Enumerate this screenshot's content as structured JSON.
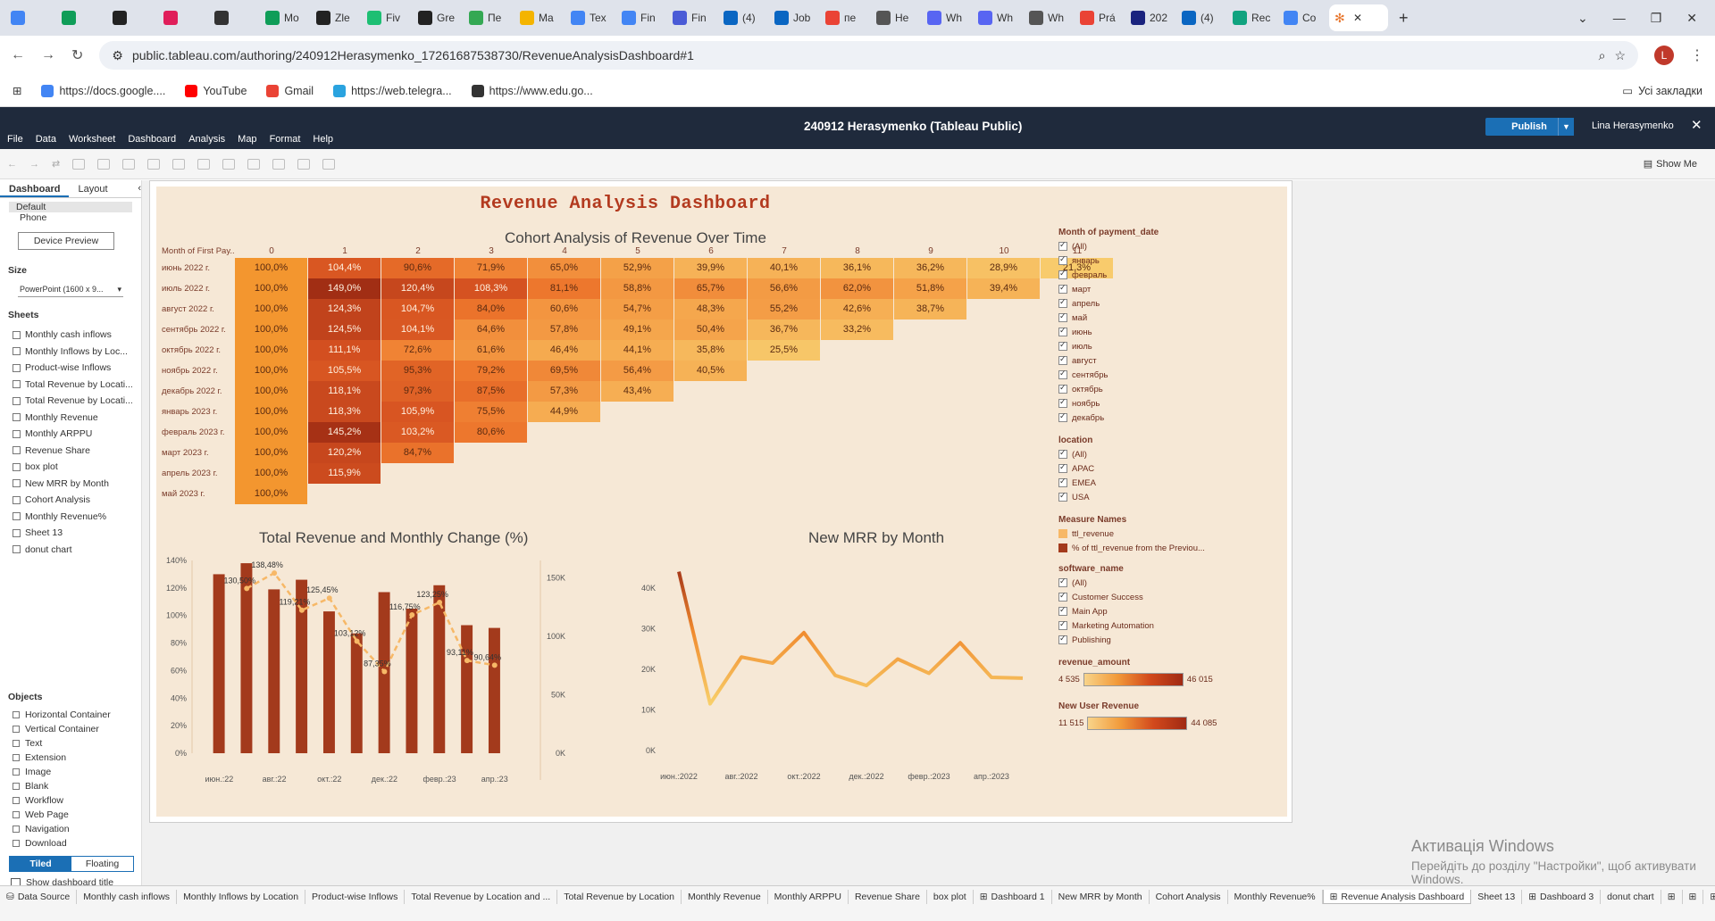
{
  "browser": {
    "tabs": [
      {
        "label": "",
        "color": "#4285f4"
      },
      {
        "label": "",
        "color": "#0f9d58"
      },
      {
        "label": "",
        "color": "#222"
      },
      {
        "label": "",
        "color": "#e01e5a"
      },
      {
        "label": "",
        "color": "#333"
      },
      {
        "label": "Mo",
        "color": "#0f9d58"
      },
      {
        "label": "Zle",
        "color": "#222"
      },
      {
        "label": "Fiv",
        "color": "#1dbf73"
      },
      {
        "label": "Gre",
        "color": "#222"
      },
      {
        "label": "Пе",
        "color": "#34a853"
      },
      {
        "label": "Ma",
        "color": "#f4b400"
      },
      {
        "label": "Tex",
        "color": "#4285f4"
      },
      {
        "label": "Fin",
        "color": "#4285f4"
      },
      {
        "label": "Fin",
        "color": "#4a5bd6"
      },
      {
        "label": "(4)",
        "color": "#0a66c2"
      },
      {
        "label": "Job",
        "color": "#0a66c2"
      },
      {
        "label": "пе",
        "color": "#ea4335"
      },
      {
        "label": "Не",
        "color": "#555"
      },
      {
        "label": "Wh",
        "color": "#5865f2"
      },
      {
        "label": "Wh",
        "color": "#5865f2"
      },
      {
        "label": "Wh",
        "color": "#555"
      },
      {
        "label": "Prá",
        "color": "#ea4335"
      },
      {
        "label": "202",
        "color": "#1a237e"
      },
      {
        "label": "(4)",
        "color": "#0a66c2"
      },
      {
        "label": "Rec",
        "color": "#10a37f"
      },
      {
        "label": "Co",
        "color": "#4285f4"
      }
    ],
    "active_tab_icon": "tableau-icon",
    "url": "public.tableau.com/authoring/240912Herasymenko_17261687538730/RevenueAnalysisDashboard#1",
    "avatar_letter": "L",
    "bookmarks": [
      {
        "label": "https://docs.google....",
        "color": "#4285f4"
      },
      {
        "label": "YouTube",
        "color": "#ff0000"
      },
      {
        "label": "Gmail",
        "color": "#ea4335"
      },
      {
        "label": "https://web.telegra...",
        "color": "#2aa3df"
      },
      {
        "label": "https://www.edu.go...",
        "color": "#333"
      }
    ],
    "all_bookmarks": "Усі закладки"
  },
  "tableau": {
    "menu": [
      "File",
      "Data",
      "Worksheet",
      "Dashboard",
      "Analysis",
      "Map",
      "Format",
      "Help"
    ],
    "title": "240912 Herasymenko (Tableau Public)",
    "publish": "Publish",
    "user": "Lina Herasymenko",
    "show_me": "Show Me"
  },
  "sidebar": {
    "tabs": [
      "Dashboard",
      "Layout"
    ],
    "device_options": [
      "Default",
      "Phone"
    ],
    "device_preview": "Device Preview",
    "size_label": "Size",
    "size_value": "PowerPoint (1600 x 9...",
    "sheets_label": "Sheets",
    "sheets": [
      "Monthly cash inflows",
      "Monthly Inflows by Loc...",
      "Product-wise Inflows",
      "Total Revenue by Locati...",
      "Total Revenue by Locati...",
      "Monthly Revenue",
      "Monthly ARPPU",
      "Revenue Share",
      "box plot",
      "New MRR by Month",
      "Cohort Analysis",
      "Monthly Revenue%",
      "Sheet 13",
      "donut chart"
    ],
    "objects_label": "Objects",
    "objects": [
      "Horizontal Container",
      "Vertical Container",
      "Text",
      "Extension",
      "Image",
      "Blank",
      "Workflow",
      "Web Page",
      "Navigation",
      "Download"
    ],
    "tiled": "Tiled",
    "floating": "Floating",
    "show_title": "Show dashboard title"
  },
  "dashboard": {
    "title": "Revenue Analysis Dashboard",
    "cohort_title": "Cohort Analysis of Revenue Over Time",
    "cohort_row_header": "Month of First Pay..",
    "cohort_cols": [
      "0",
      "1",
      "2",
      "3",
      "4",
      "5",
      "6",
      "7",
      "8",
      "9",
      "10",
      "11"
    ],
    "cohort_rows": [
      {
        "label": "июнь 2022 г.",
        "values": [
          "100,0%",
          "104,4%",
          "90,6%",
          "71,9%",
          "65,0%",
          "52,9%",
          "39,9%",
          "40,1%",
          "36,1%",
          "36,2%",
          "28,9%",
          "21,3%"
        ]
      },
      {
        "label": "июль 2022 г.",
        "values": [
          "100,0%",
          "149,0%",
          "120,4%",
          "108,3%",
          "81,1%",
          "58,8%",
          "65,7%",
          "56,6%",
          "62,0%",
          "51,8%",
          "39,4%"
        ]
      },
      {
        "label": "август 2022 г.",
        "values": [
          "100,0%",
          "124,3%",
          "104,7%",
          "84,0%",
          "60,6%",
          "54,7%",
          "48,3%",
          "55,2%",
          "42,6%",
          "38,7%"
        ]
      },
      {
        "label": "сентябрь 2022 г.",
        "values": [
          "100,0%",
          "124,5%",
          "104,1%",
          "64,6%",
          "57,8%",
          "49,1%",
          "50,4%",
          "36,7%",
          "33,2%"
        ]
      },
      {
        "label": "октябрь 2022 г.",
        "values": [
          "100,0%",
          "111,1%",
          "72,6%",
          "61,6%",
          "46,4%",
          "44,1%",
          "35,8%",
          "25,5%"
        ]
      },
      {
        "label": "ноябрь 2022 г.",
        "values": [
          "100,0%",
          "105,5%",
          "95,3%",
          "79,2%",
          "69,5%",
          "56,4%",
          "40,5%"
        ]
      },
      {
        "label": "декабрь 2022 г.",
        "values": [
          "100,0%",
          "118,1%",
          "97,3%",
          "87,5%",
          "57,3%",
          "43,4%"
        ]
      },
      {
        "label": "январь 2023 г.",
        "values": [
          "100,0%",
          "118,3%",
          "105,9%",
          "75,5%",
          "44,9%"
        ]
      },
      {
        "label": "февраль 2023 г.",
        "values": [
          "100,0%",
          "145,2%",
          "103,2%",
          "80,6%"
        ]
      },
      {
        "label": "март 2023 г.",
        "values": [
          "100,0%",
          "120,2%",
          "84,7%"
        ]
      },
      {
        "label": "апрель 2023 г.",
        "values": [
          "100,0%",
          "115,9%"
        ]
      },
      {
        "label": "май 2023 г.",
        "values": [
          "100,0%"
        ]
      }
    ],
    "legend": {
      "month_title": "Month of payment_date",
      "months": [
        "(All)",
        "январь",
        "февраль",
        "март",
        "апрель",
        "май",
        "июнь",
        "июль",
        "август",
        "сентябрь",
        "октябрь",
        "ноябрь",
        "декабрь"
      ],
      "location_title": "location",
      "locations": [
        "(All)",
        "APAC",
        "EMEA",
        "USA"
      ],
      "measure_title": "Measure Names",
      "measures": [
        {
          "label": "ttl_revenue",
          "color": "#f7b867"
        },
        {
          "label": "% of ttl_revenue from the Previou...",
          "color": "#a33a1c"
        }
      ],
      "software_title": "software_name",
      "software": [
        "(All)",
        "Customer Success",
        "Main App",
        "Marketing Automation",
        "Publishing"
      ],
      "revenue_amount_title": "revenue_amount",
      "revenue_amount_min": "4 535",
      "revenue_amount_max": "46 015",
      "new_user_title": "New User Revenue",
      "new_user_min": "11 515",
      "new_user_max": "44 085"
    }
  },
  "chart_data": [
    {
      "type": "bar",
      "title": "Total Revenue and Monthly Change (%)",
      "categories": [
        "июн.:22",
        "июл.:22",
        "авг.:22",
        "сент.:22",
        "окт.:22",
        "нояб.:22",
        "дек.:22",
        "янв.:23",
        "февр.:23",
        "март:23",
        "апр.:23",
        "май:23"
      ],
      "x_tick_labels": [
        "июн.:22",
        "авг.:22",
        "окт.:22",
        "дек.:22",
        "февр.:23",
        "апр.:23"
      ],
      "series": [
        {
          "name": "ttl_revenue",
          "type": "bar",
          "color": "#a33a1c",
          "values": [
            130,
            138,
            119,
            126,
            103,
            87,
            117,
            105,
            122,
            93,
            91
          ]
        },
        {
          "name": "% of ttl_revenue from the Previou...",
          "type": "line",
          "color": "#f7b867",
          "values": [
            null,
            130.5,
            138.48,
            119.21,
            125.45,
            103.12,
            87.35,
            116.75,
            123.25,
            93.11,
            90.64
          ],
          "labels": [
            "",
            "130,50%",
            "138,48%",
            "119,21%",
            "125,45%",
            "103,12%",
            "87,35%",
            "116,75%",
            "123,25%",
            "93,11%",
            "90,64%"
          ]
        }
      ],
      "y_left_ticks": [
        "0%",
        "20%",
        "40%",
        "60%",
        "80%",
        "100%",
        "120%",
        "140%"
      ],
      "y_right_ticks": [
        "0K",
        "50K",
        "100K",
        "150K"
      ],
      "ylim_left": [
        0,
        140
      ]
    },
    {
      "type": "line",
      "title": "New MRR by Month",
      "categories": [
        "июн.:2022",
        "июл.:2022",
        "авг.:2022",
        "сент.:2022",
        "окт.:2022",
        "нояб.:2022",
        "дек.:2022",
        "янв.:2023",
        "февр.:2023",
        "март:2023",
        "апр.:2023",
        "май:2023"
      ],
      "x_tick_labels": [
        "июн.:2022",
        "авг.:2022",
        "окт.:2022",
        "дек.:2022",
        "февр.:2023",
        "апр.:2023"
      ],
      "values": [
        44000,
        11500,
        23000,
        21500,
        29000,
        18500,
        16000,
        22500,
        19000,
        26500,
        18000,
        17800
      ],
      "y_ticks": [
        "0K",
        "10K",
        "20K",
        "30K",
        "40K"
      ],
      "ylim": [
        0,
        45000
      ]
    }
  ],
  "bottom_tabs": [
    "Data Source",
    "Monthly cash inflows",
    "Monthly Inflows by Location",
    "Product-wise Inflows",
    "Total Revenue by Location and ...",
    "Total Revenue by Location",
    "Monthly Revenue",
    "Monthly ARPPU",
    "Revenue Share",
    "box plot",
    "Dashboard 1",
    "New MRR by Month",
    "Cohort Analysis",
    "Monthly Revenue%",
    "Revenue Analysis Dashboard",
    "Sheet 13",
    "Dashboard 3",
    "donut chart"
  ],
  "active_bottom_tab": "Revenue Analysis Dashboard",
  "windows_activation": {
    "line1": "Активація Windows",
    "line2": "Перейдіть до розділу \"Настройки\", щоб активувати Windows."
  }
}
